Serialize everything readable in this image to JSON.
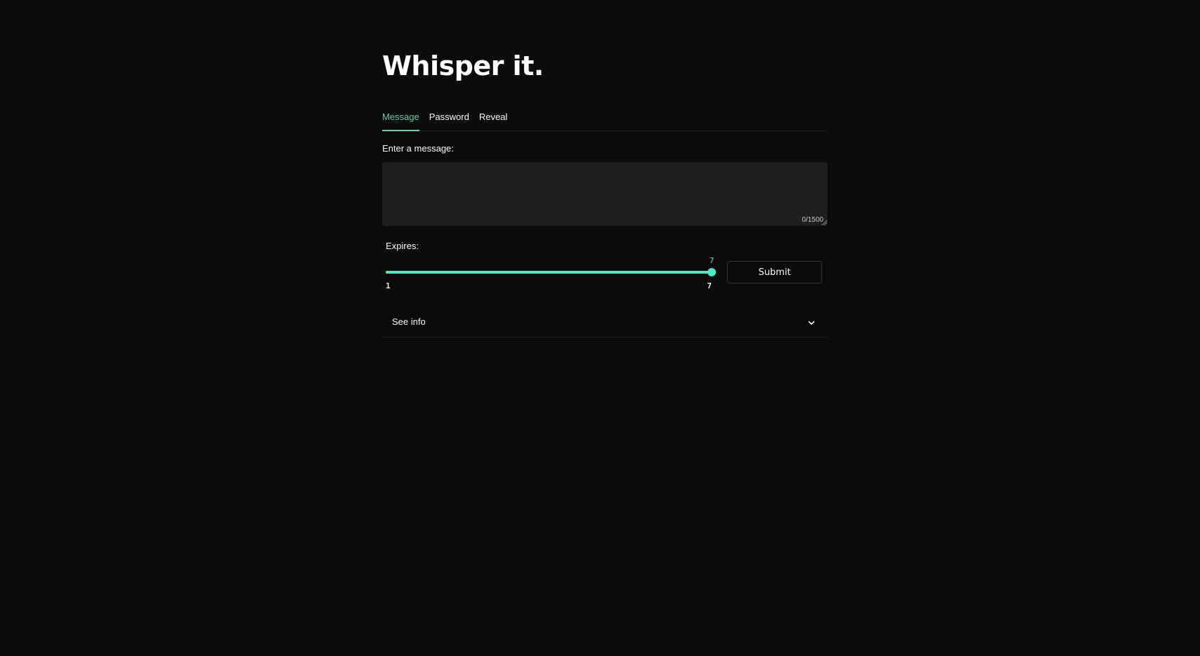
{
  "app": {
    "title": "Whisper it."
  },
  "tabs": [
    {
      "label": "Message",
      "active": true
    },
    {
      "label": "Password",
      "active": false
    },
    {
      "label": "Reveal",
      "active": false
    }
  ],
  "message": {
    "label": "Enter a message:",
    "value": "",
    "placeholder": "",
    "counter": "0/1500"
  },
  "expires": {
    "label": "Expires:",
    "min": 1,
    "max": 7,
    "value": 7,
    "min_label": "1",
    "max_label": "7",
    "value_label": "7"
  },
  "submit": {
    "label": "Submit"
  },
  "expander": {
    "label": "See info",
    "icon": "chevron-down-icon"
  },
  "colors": {
    "background": "#0b0b0c",
    "accent": "#5fd3a6",
    "slider": "#4fe8c6",
    "input_bg": "#1e1e20"
  }
}
